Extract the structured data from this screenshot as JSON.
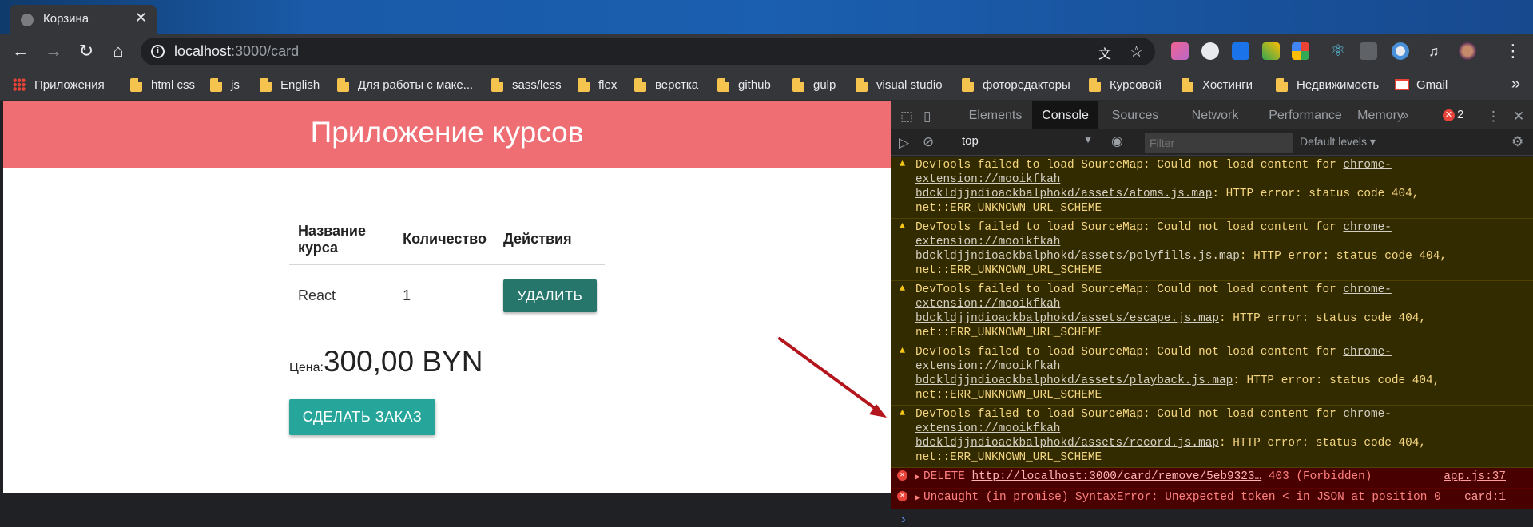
{
  "tab": {
    "title": "Корзина",
    "close": "✕"
  },
  "omnibox": {
    "host": "localhost",
    "path": ":3000/card"
  },
  "bookmarks": [
    {
      "label": "Приложения",
      "kind": "apps"
    },
    {
      "label": "html css",
      "kind": "folder"
    },
    {
      "label": "js",
      "kind": "folder"
    },
    {
      "label": "English",
      "kind": "folder"
    },
    {
      "label": "Для работы с маке...",
      "kind": "folder"
    },
    {
      "label": "sass/less",
      "kind": "folder"
    },
    {
      "label": "flex",
      "kind": "folder"
    },
    {
      "label": "верстка",
      "kind": "folder"
    },
    {
      "label": "github",
      "kind": "folder"
    },
    {
      "label": "gulp",
      "kind": "folder"
    },
    {
      "label": "visual studio",
      "kind": "folder"
    },
    {
      "label": "фоторедакторы",
      "kind": "folder"
    },
    {
      "label": "Курсовой",
      "kind": "folder"
    },
    {
      "label": "Хостинги",
      "kind": "folder"
    },
    {
      "label": "Недвижимость",
      "kind": "folder"
    },
    {
      "label": "Gmail",
      "kind": "gmail"
    }
  ],
  "page": {
    "title": "Приложение курсов",
    "table": {
      "headers": [
        "Название курса",
        "Количество",
        "Действия"
      ],
      "rows": [
        {
          "name": "React",
          "qty": "1",
          "action": "УДАЛИТЬ"
        }
      ]
    },
    "price_label": "Цена:",
    "price_value": "300,00 BYN",
    "order_button": "СДЕЛАТЬ ЗАКАЗ"
  },
  "devtools": {
    "tabs": [
      "Elements",
      "Console",
      "Sources",
      "Network",
      "Performance",
      "Memory"
    ],
    "active_tab": "Console",
    "more": "»",
    "error_count": "2",
    "context": "top",
    "filter_placeholder": "Filter",
    "levels": "Default levels ▾",
    "warnings": [
      {
        "pre": "DevTools failed to load SourceMap: Could not load content for ",
        "link1": "chrome-extension://mooikfkah",
        "link2": "bdckldjjndioackbalphokd/assets/atoms.js.map",
        "post": ": HTTP error: status code 404,",
        "last": "net::ERR_UNKNOWN_URL_SCHEME"
      },
      {
        "pre": "DevTools failed to load SourceMap: Could not load content for ",
        "link1": "chrome-extension://mooikfkah",
        "link2": "bdckldjjndioackbalphokd/assets/polyfills.js.map",
        "post": ": HTTP error: status code 404,",
        "last": "net::ERR_UNKNOWN_URL_SCHEME"
      },
      {
        "pre": "DevTools failed to load SourceMap: Could not load content for ",
        "link1": "chrome-extension://mooikfkah",
        "link2": "bdckldjjndioackbalphokd/assets/escape.js.map",
        "post": ": HTTP error: status code 404,",
        "last": "net::ERR_UNKNOWN_URL_SCHEME"
      },
      {
        "pre": "DevTools failed to load SourceMap: Could not load content for ",
        "link1": "chrome-extension://mooikfkah",
        "link2": "bdckldjjndioackbalphokd/assets/playback.js.map",
        "post": ": HTTP error: status code 404,",
        "last": "net::ERR_UNKNOWN_URL_SCHEME"
      },
      {
        "pre": "DevTools failed to load SourceMap: Could not load content for ",
        "link1": "chrome-extension://mooikfkah",
        "link2": "bdckldjjndioackbalphokd/assets/record.js.map",
        "post": ": HTTP error: status code 404,",
        "last": "net::ERR_UNKNOWN_URL_SCHEME"
      }
    ],
    "errors": [
      {
        "pre": "DELETE ",
        "link": "http://localhost:3000/card/remove/5eb9323…",
        "post": " 403 (Forbidden)",
        "src": "app.js:37"
      },
      {
        "pre": "Uncaught (in promise) SyntaxError: Unexpected token < in JSON at position 0",
        "link": "",
        "post": "",
        "src": "card:1"
      }
    ],
    "prompt": "›"
  },
  "colors": {
    "header": "#ee6e73",
    "delete_btn": "#26766b",
    "order_btn": "#26a69a",
    "arrow": "#b3161c"
  }
}
